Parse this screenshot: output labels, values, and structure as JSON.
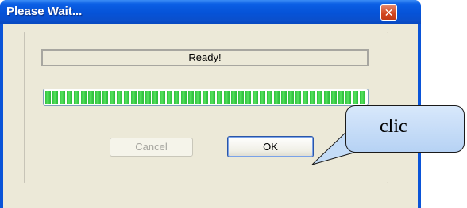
{
  "window": {
    "title": "Please Wait...",
    "close_icon": "close-icon"
  },
  "status": {
    "text": "Ready!"
  },
  "progress": {
    "value_percent": 100
  },
  "buttons": {
    "cancel_label": "Cancel",
    "ok_label": "OK"
  },
  "callout": {
    "text": "clic"
  },
  "colors": {
    "titlebar": "#0653d8",
    "client": "#ece9d8",
    "progress_fill": "#2fc03d",
    "close_button": "#d2451f",
    "callout_fill": "#c4dcf7"
  }
}
